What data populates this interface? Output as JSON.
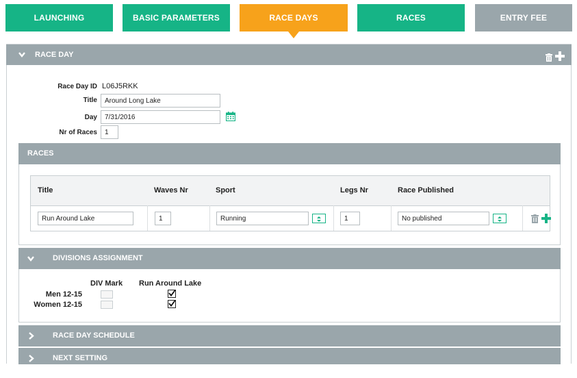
{
  "tabs": [
    {
      "label": "LAUNCHING",
      "state": "green"
    },
    {
      "label": "BASIC PARAMETERS",
      "state": "green"
    },
    {
      "label": "RACE DAYS",
      "state": "active"
    },
    {
      "label": "RACES",
      "state": "green"
    },
    {
      "label": "ENTRY FEE",
      "state": "gray"
    }
  ],
  "colors": {
    "green": "#16b486",
    "orange": "#f7a21b",
    "bar_gray": "#9aa6ab"
  },
  "race_day": {
    "header": "RACE DAY",
    "id_label": "Race Day ID",
    "id_value": "L06J5RKK",
    "title_label": "Title",
    "title_value": "Around Long Lake",
    "day_label": "Day",
    "day_value": "7/31/2016",
    "nr_races_label": "Nr of Races",
    "nr_races_value": "1"
  },
  "races": {
    "header": "RACES",
    "columns": [
      "Title",
      "Waves Nr",
      "Sport",
      "Legs Nr",
      "Race Published"
    ],
    "row": {
      "title": "Run Around Lake",
      "waves_nr": "1",
      "sport": "Running",
      "legs_nr": "1",
      "race_published": "No published"
    }
  },
  "divisions": {
    "header": "DIVISIONS ASSIGNMENT",
    "col_mark": "DIV Mark",
    "col_race": "Run Around Lake",
    "rows": [
      {
        "name": "Men 12-15",
        "checked": true
      },
      {
        "name": "Women 12-15",
        "checked": true
      }
    ]
  },
  "collapsed": {
    "schedule": "RACE DAY SCHEDULE",
    "next": "NEXT SETTING"
  }
}
